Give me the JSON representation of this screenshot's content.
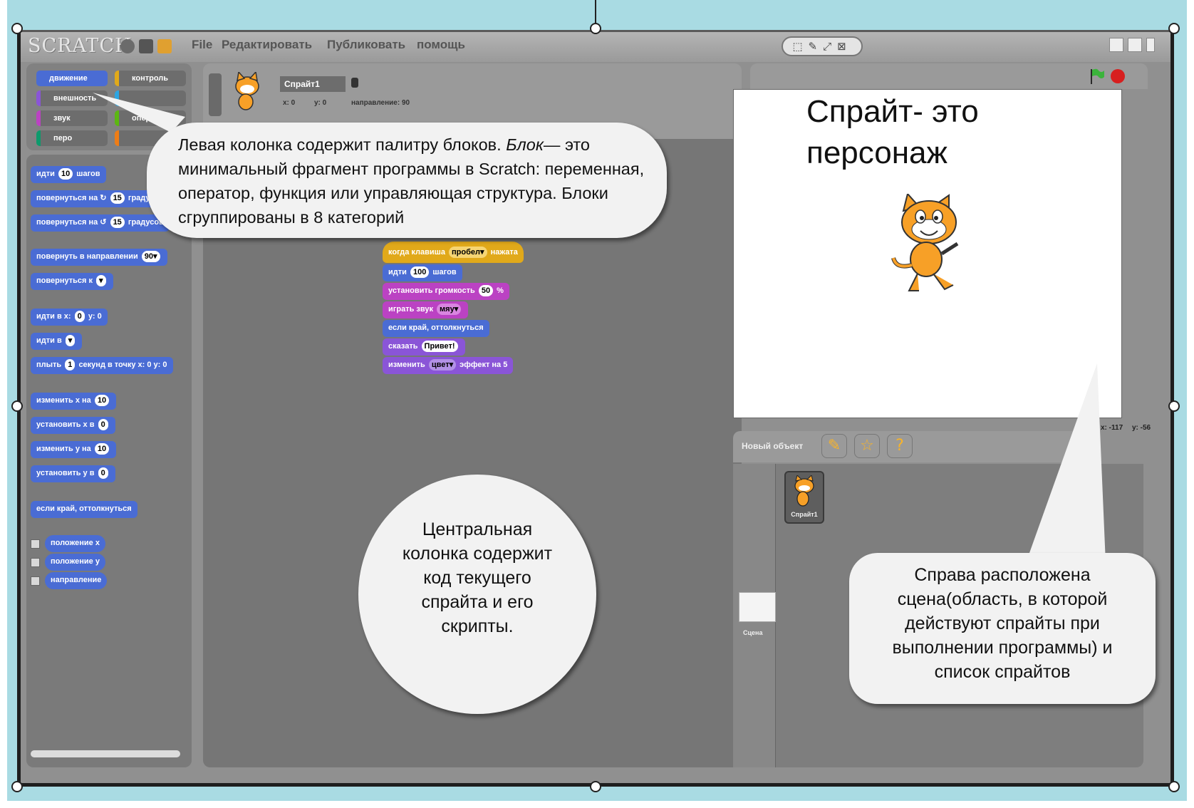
{
  "menubar": {
    "logo": "SCRATCH",
    "items": [
      "File",
      "Редактировать",
      "Публиковать",
      "помощь"
    ]
  },
  "palette": {
    "categories": [
      {
        "label": "движение",
        "color": "#4a6cd4"
      },
      {
        "label": "контроль",
        "color": "#e1a91a"
      },
      {
        "label": "внешность",
        "color": "#8a55d7"
      },
      {
        "label": "",
        "color": "#2ca5e2"
      },
      {
        "label": "звук",
        "color": "#bb42c3"
      },
      {
        "label": "операторы",
        "color": "#5cb712"
      },
      {
        "label": "перо",
        "color": "#0e9a6c"
      },
      {
        "label": "",
        "color": "#ee7d16"
      }
    ],
    "blocks": [
      {
        "pre": "идти",
        "num": "10",
        "post": "шагов"
      },
      {
        "pre": "повернуться на ↻",
        "num": "15",
        "post": "градусов"
      },
      {
        "pre": "повернуться на ↺",
        "num": "15",
        "post": "градусов"
      },
      {
        "pre": "повернуть в направлении",
        "num": "90▾",
        "post": ""
      },
      {
        "pre": "повернуться к",
        "num": "▾",
        "post": ""
      },
      {
        "pre": "идти в x:",
        "num": "0",
        "post": "y: 0"
      },
      {
        "pre": "идти в",
        "num": "▾",
        "post": ""
      },
      {
        "pre": "плыть",
        "num": "1",
        "post": "секунд в точку x: 0 y: 0"
      },
      {
        "pre": "изменить x на",
        "num": "10",
        "post": ""
      },
      {
        "pre": "установить x в",
        "num": "0",
        "post": ""
      },
      {
        "pre": "изменить y на",
        "num": "10",
        "post": ""
      },
      {
        "pre": "установить y в",
        "num": "0",
        "post": ""
      },
      {
        "pre": "если край, оттолкнуться",
        "num": "",
        "post": ""
      }
    ],
    "reporters": [
      "положение x",
      "положение y",
      "направление"
    ]
  },
  "sprite_info": {
    "name": "Спрайт1",
    "x": "x: 0",
    "y": "y: 0",
    "direction": "направление: 90"
  },
  "script": [
    {
      "pre": "когда клавиша",
      "num": "пробел▾",
      "post": "нажата",
      "color": "#e1a91a"
    },
    {
      "pre": "идти",
      "num": "100",
      "post": "шагов",
      "color": "#4a6cd4"
    },
    {
      "pre": "установить громкость",
      "num": "50",
      "post": "%",
      "color": "#bb42c3"
    },
    {
      "pre": "играть звук",
      "num": "мяу▾",
      "post": "",
      "color": "#bb42c3"
    },
    {
      "pre": "если край, оттолкнуться",
      "num": "",
      "post": "",
      "color": "#4a6cd4"
    },
    {
      "pre": "сказать",
      "num": "Привет!",
      "post": "",
      "color": "#8a55d7"
    },
    {
      "pre": "изменить",
      "num": "цвет▾",
      "post": "эффект на 5",
      "color": "#8a55d7"
    }
  ],
  "stage": {
    "coords_x": "x: -117",
    "coords_y": "y: -56",
    "new_object": "Новый объект",
    "sprite_thumb": "Спрайт1",
    "stage_thumb": "Сцена"
  },
  "callouts": {
    "left": "Левая колонка содержит палитру блоков.",
    "left_em": "Блок",
    "left_rest": "— это минимальный фрагмент программы в Scratch: переменная, оператор, функция или управляющая структура. Блоки сгруппированы в 8 категорий",
    "sprite_title_1": "Спрайт- это",
    "sprite_title_2": "персонаж",
    "center": "Центральная колонка содержит код текущего спрайта и его скрипты.",
    "right": "Справа расположена сцена(область, в которой действуют спрайты при выполнении программы) и список спрайтов"
  },
  "colors": {
    "motion": "#4a6cd4",
    "callout_bg": "#f2f2f2",
    "background_band": "#a9dbe3"
  }
}
